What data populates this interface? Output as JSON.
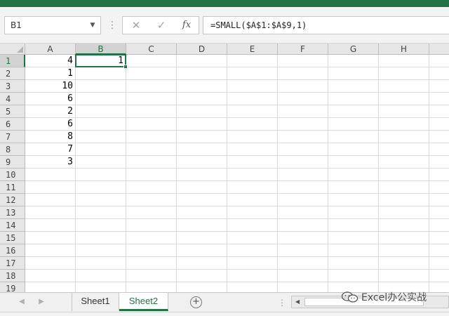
{
  "formula_bar": {
    "name_box": "B1",
    "cancel_icon": "✕",
    "enter_icon": "✓",
    "insert_function_label": "fx",
    "formula": "=SMALL($A$1:$A$9,1)"
  },
  "grid": {
    "columns": [
      "A",
      "B",
      "C",
      "D",
      "E",
      "F",
      "G",
      "H"
    ],
    "rows": [
      "1",
      "2",
      "3",
      "4",
      "5",
      "6",
      "7",
      "8",
      "9",
      "10",
      "11",
      "12",
      "13",
      "14",
      "15",
      "16",
      "17",
      "18",
      "19"
    ],
    "column_a_values": [
      "4",
      "1",
      "10",
      "6",
      "2",
      "6",
      "8",
      "7",
      "3"
    ],
    "b1_value": "1",
    "active_cell": "B1"
  },
  "sheets": {
    "tabs": [
      "Sheet1",
      "Sheet2"
    ],
    "active": "Sheet2"
  },
  "watermark": {
    "text": "Excel办公实战"
  },
  "colors": {
    "accent": "#217346",
    "header_bg": "#e6e6e6",
    "gridline": "#dadcdd"
  }
}
